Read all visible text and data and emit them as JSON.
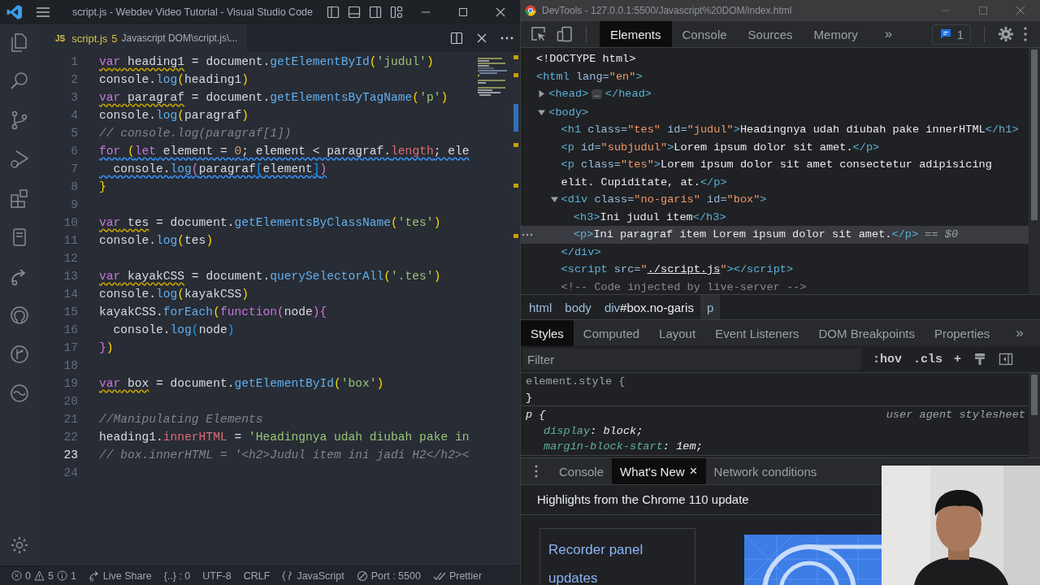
{
  "vscode": {
    "title": "script.js - Webdev Video Tutorial - Visual Studio Code",
    "tab": {
      "badge": "JS",
      "name": "script.js",
      "problems": "5",
      "path": "Javascript DOM\\script.js\\..."
    },
    "lines": [
      {
        "number": "1",
        "current": false,
        "tokens": [
          {
            "kind": "keyword",
            "text": "var",
            "warning": true
          },
          {
            "kind": "ident",
            "text": " heading1",
            "warning": true
          },
          {
            "kind": "ident",
            "text": " = document."
          },
          {
            "kind": "function",
            "text": "getElementById"
          },
          {
            "kind": "bracket1",
            "text": "("
          },
          {
            "kind": "string",
            "text": "'judul'"
          },
          {
            "kind": "bracket1",
            "text": ")"
          }
        ]
      },
      {
        "number": "2",
        "current": false,
        "tokens": [
          {
            "kind": "ident",
            "text": "console."
          },
          {
            "kind": "function",
            "text": "log"
          },
          {
            "kind": "bracket1",
            "text": "("
          },
          {
            "kind": "ident",
            "text": "heading1"
          },
          {
            "kind": "bracket1",
            "text": ")"
          }
        ]
      },
      {
        "number": "3",
        "current": false,
        "tokens": [
          {
            "kind": "keyword",
            "text": "var",
            "warning": true
          },
          {
            "kind": "ident",
            "text": " paragraf",
            "warning": true
          },
          {
            "kind": "ident",
            "text": " = document."
          },
          {
            "kind": "function",
            "text": "getElementsByTagName"
          },
          {
            "kind": "bracket1",
            "text": "("
          },
          {
            "kind": "string",
            "text": "'p'"
          },
          {
            "kind": "bracket1",
            "text": ")"
          }
        ]
      },
      {
        "number": "4",
        "current": false,
        "tokens": [
          {
            "kind": "ident",
            "text": "console."
          },
          {
            "kind": "function",
            "text": "log"
          },
          {
            "kind": "bracket1",
            "text": "("
          },
          {
            "kind": "ident",
            "text": "paragraf"
          },
          {
            "kind": "bracket1",
            "text": ")"
          }
        ]
      },
      {
        "number": "5",
        "current": false,
        "tokens": [
          {
            "kind": "comment",
            "text": "// console.log(paragraf[1])"
          }
        ]
      },
      {
        "number": "6",
        "current": false,
        "tokens": [
          {
            "kind": "keyword",
            "text": "for",
            "info": true
          },
          {
            "kind": "bracket1",
            "text": " (",
            "info": true
          },
          {
            "kind": "keyword",
            "text": "let",
            "info": true
          },
          {
            "kind": "ident",
            "text": " element = ",
            "info": true
          },
          {
            "kind": "number",
            "text": "0",
            "info": true
          },
          {
            "kind": "ident",
            "text": "; element < paragraf.",
            "info": true
          },
          {
            "kind": "property",
            "text": "length",
            "info": true
          },
          {
            "kind": "ident",
            "text": "; ele",
            "info": true
          }
        ]
      },
      {
        "number": "7",
        "current": false,
        "tokens": [
          {
            "kind": "ident",
            "text": "  console.",
            "info": true
          },
          {
            "kind": "function",
            "text": "log",
            "info": true
          },
          {
            "kind": "bracket2",
            "text": "(",
            "info": true
          },
          {
            "kind": "ident",
            "text": "paragraf",
            "info": true
          },
          {
            "kind": "bracket3",
            "text": "[",
            "info": true
          },
          {
            "kind": "ident",
            "text": "element",
            "info": true
          },
          {
            "kind": "bracket3",
            "text": "]",
            "info": true
          },
          {
            "kind": "bracket2",
            "text": ")",
            "info": true
          }
        ]
      },
      {
        "number": "8",
        "current": false,
        "tokens": [
          {
            "kind": "bracket1",
            "text": "}"
          }
        ]
      },
      {
        "number": "9",
        "current": false
      },
      {
        "number": "10",
        "current": false,
        "tokens": [
          {
            "kind": "keyword",
            "text": "var",
            "warning": true
          },
          {
            "kind": "ident",
            "text": " tes",
            "warning": true
          },
          {
            "kind": "ident",
            "text": " = document."
          },
          {
            "kind": "function",
            "text": "getElementsByClassName"
          },
          {
            "kind": "bracket1",
            "text": "("
          },
          {
            "kind": "string",
            "text": "'tes'"
          },
          {
            "kind": "bracket1",
            "text": ")"
          }
        ]
      },
      {
        "number": "11",
        "current": false,
        "tokens": [
          {
            "kind": "ident",
            "text": "console."
          },
          {
            "kind": "function",
            "text": "log"
          },
          {
            "kind": "bracket1",
            "text": "("
          },
          {
            "kind": "ident",
            "text": "tes"
          },
          {
            "kind": "bracket1",
            "text": ")"
          }
        ]
      },
      {
        "number": "12",
        "current": false
      },
      {
        "number": "13",
        "current": false,
        "tokens": [
          {
            "kind": "keyword",
            "text": "var",
            "warning": true
          },
          {
            "kind": "ident",
            "text": " kayakCSS",
            "warning": true
          },
          {
            "kind": "ident",
            "text": " = document."
          },
          {
            "kind": "function",
            "text": "querySelectorAll"
          },
          {
            "kind": "bracket1",
            "text": "("
          },
          {
            "kind": "string",
            "text": "'.tes'"
          },
          {
            "kind": "bracket1",
            "text": ")"
          }
        ]
      },
      {
        "number": "14",
        "current": false,
        "tokens": [
          {
            "kind": "ident",
            "text": "console."
          },
          {
            "kind": "function",
            "text": "log"
          },
          {
            "kind": "bracket1",
            "text": "("
          },
          {
            "kind": "ident",
            "text": "kayakCSS"
          },
          {
            "kind": "bracket1",
            "text": ")"
          }
        ]
      },
      {
        "number": "15",
        "current": false,
        "tokens": [
          {
            "kind": "ident",
            "text": "kayakCSS."
          },
          {
            "kind": "function",
            "text": "forEach"
          },
          {
            "kind": "bracket1",
            "text": "("
          },
          {
            "kind": "keyword",
            "text": "function"
          },
          {
            "kind": "bracket2",
            "text": "("
          },
          {
            "kind": "ident",
            "text": "node"
          },
          {
            "kind": "bracket2",
            "text": ")"
          },
          {
            "kind": "bracket2",
            "text": "{"
          }
        ]
      },
      {
        "number": "16",
        "current": false,
        "tokens": [
          {
            "kind": "ident",
            "text": "  console."
          },
          {
            "kind": "function",
            "text": "log"
          },
          {
            "kind": "bracket3",
            "text": "("
          },
          {
            "kind": "ident",
            "text": "node"
          },
          {
            "kind": "bracket3",
            "text": ")"
          }
        ]
      },
      {
        "number": "17",
        "current": false,
        "tokens": [
          {
            "kind": "bracket2",
            "text": "}"
          },
          {
            "kind": "bracket1",
            "text": ")"
          }
        ]
      },
      {
        "number": "18",
        "current": false
      },
      {
        "number": "19",
        "current": false,
        "tokens": [
          {
            "kind": "keyword",
            "text": "var",
            "warning": true
          },
          {
            "kind": "ident",
            "text": " box",
            "warning": true
          },
          {
            "kind": "ident",
            "text": " = document."
          },
          {
            "kind": "function",
            "text": "getElementById"
          },
          {
            "kind": "bracket1",
            "text": "("
          },
          {
            "kind": "string",
            "text": "'box'"
          },
          {
            "kind": "bracket1",
            "text": ")"
          }
        ]
      },
      {
        "number": "20",
        "current": false
      },
      {
        "number": "21",
        "current": false,
        "tokens": [
          {
            "kind": "comment",
            "text": "//Manipulating Elements"
          }
        ]
      },
      {
        "number": "22",
        "current": false,
        "tokens": [
          {
            "kind": "ident",
            "text": "heading1."
          },
          {
            "kind": "property",
            "text": "innerHTML"
          },
          {
            "kind": "ident",
            "text": " = "
          },
          {
            "kind": "string",
            "text": "'Headingnya udah diubah pake in"
          }
        ]
      },
      {
        "number": "23",
        "current": true,
        "tokens": [
          {
            "kind": "comment",
            "text": "// box.innerHTML = '<h2>Judul item ini jadi H2</h2><"
          }
        ]
      },
      {
        "number": "24",
        "current": false
      }
    ],
    "status_bar": {
      "errors": "0",
      "warnings": "5",
      "infos": "1",
      "items": [
        {
          "kind": "live-share",
          "text": "Live Share"
        },
        {
          "kind": "plain",
          "text": "{..} : 0"
        },
        {
          "kind": "plain",
          "text": "UTF-8"
        },
        {
          "kind": "plain",
          "text": "CRLF"
        },
        {
          "kind": "language",
          "text": "JavaScript"
        },
        {
          "kind": "port",
          "text": "Port : 5500"
        },
        {
          "kind": "prettier",
          "text": "Prettier"
        }
      ]
    }
  },
  "devtools": {
    "title": "DevTools - 127.0.0.1:5500/Javascript%20DOM/index.html",
    "tabs": [
      {
        "label": "Elements",
        "selected": true
      },
      {
        "label": "Console",
        "selected": false
      },
      {
        "label": "Sources",
        "selected": false
      },
      {
        "label": "Memory",
        "selected": false
      }
    ],
    "more_tabs": "»",
    "issues": "1",
    "dom": [
      {
        "tokens": [
          {
            "kind": "doctype",
            "text": "<!DOCTYPE html>"
          }
        ]
      },
      {
        "tokens": [
          {
            "kind": "tag",
            "text": "<html"
          },
          {
            "kind": "attr",
            "text": " lang="
          },
          {
            "kind": "value",
            "text": "\"en\""
          },
          {
            "kind": "tag",
            "text": ">"
          }
        ],
        "children": [
          {
            "expanded": false,
            "tokens": [
              {
                "kind": "tag",
                "text": "<head>"
              },
              {
                "kind": "ellipsis",
                "text": "…"
              },
              {
                "kind": "tag",
                "text": "</head>"
              }
            ]
          },
          {
            "expanded": true,
            "tokens": [
              {
                "kind": "tag",
                "text": "<body>"
              }
            ],
            "children": [
              {
                "tokens": [
                  {
                    "kind": "tag",
                    "text": "<h1"
                  },
                  {
                    "kind": "attr",
                    "text": " class="
                  },
                  {
                    "kind": "value",
                    "text": "\"tes\""
                  },
                  {
                    "kind": "attr",
                    "text": " id="
                  },
                  {
                    "kind": "value",
                    "text": "\"judul\""
                  },
                  {
                    "kind": "tag",
                    "text": ">"
                  },
                  {
                    "kind": "text",
                    "text": "Headingnya udah diubah pake innerHTML"
                  },
                  {
                    "kind": "tag",
                    "text": "</h1>"
                  }
                ]
              },
              {
                "tokens": [
                  {
                    "kind": "tag",
                    "text": "<p"
                  },
                  {
                    "kind": "attr",
                    "text": " id="
                  },
                  {
                    "kind": "value",
                    "text": "\"subjudul\""
                  },
                  {
                    "kind": "tag",
                    "text": ">"
                  },
                  {
                    "kind": "text",
                    "text": "Lorem ipsum dolor sit amet."
                  },
                  {
                    "kind": "tag",
                    "text": "</p>"
                  }
                ]
              },
              {
                "tokens": [
                  {
                    "kind": "tag",
                    "text": "<p"
                  },
                  {
                    "kind": "attr",
                    "text": " class="
                  },
                  {
                    "kind": "value",
                    "text": "\"tes\""
                  },
                  {
                    "kind": "tag",
                    "text": ">"
                  },
                  {
                    "kind": "text",
                    "text": "Lorem ipsum dolor sit amet consectetur adipisicing elit. Cupiditate, at."
                  },
                  {
                    "kind": "tag",
                    "text": "</p>"
                  }
                ]
              },
              {
                "expanded": true,
                "closing": "</div>",
                "tokens": [
                  {
                    "kind": "tag",
                    "text": "<div"
                  },
                  {
                    "kind": "attr",
                    "text": " class="
                  },
                  {
                    "kind": "value",
                    "text": "\"no-garis\""
                  },
                  {
                    "kind": "attr",
                    "text": " id="
                  },
                  {
                    "kind": "value",
                    "text": "\"box\""
                  },
                  {
                    "kind": "tag",
                    "text": ">"
                  }
                ],
                "children": [
                  {
                    "selected": false,
                    "tokens": [
                      {
                        "kind": "tag",
                        "text": "<h3>"
                      },
                      {
                        "kind": "text",
                        "text": "Ini judul item"
                      },
                      {
                        "kind": "tag",
                        "text": "</h3>"
                      }
                    ]
                  },
                  {
                    "selected": true,
                    "tokens": [
                      {
                        "kind": "tag",
                        "text": "<p>"
                      },
                      {
                        "kind": "text",
                        "text": "Ini paragraf item Lorem ipsum dolor sit amet."
                      },
                      {
                        "kind": "tag",
                        "text": "</p>"
                      },
                      {
                        "kind": "marker",
                        "text": " == $0"
                      }
                    ]
                  }
                ]
              },
              {
                "tokens": [
                  {
                    "kind": "tag",
                    "text": "<script"
                  },
                  {
                    "kind": "attr",
                    "text": " src="
                  },
                  {
                    "kind": "value",
                    "text": "\""
                  },
                  {
                    "kind": "link",
                    "text": "./script.js"
                  },
                  {
                    "kind": "value",
                    "text": "\""
                  },
                  {
                    "kind": "tag",
                    "text": "></script>"
                  }
                ]
              },
              {
                "tokens": [
                  {
                    "kind": "comment",
                    "text": "<!-- Code injected by live-server -->"
                  }
                ]
              }
            ]
          }
        ]
      }
    ],
    "breadcrumbs": [
      {
        "tag": "html",
        "selected": false
      },
      {
        "tag": "body",
        "selected": false
      },
      {
        "tag": "div",
        "detail": "#box.no-garis",
        "selected": false
      },
      {
        "tag": "p",
        "selected": true
      }
    ],
    "style_tabs": [
      {
        "label": "Styles",
        "selected": true
      },
      {
        "label": "Computed",
        "selected": false
      },
      {
        "label": "Layout",
        "selected": false
      },
      {
        "label": "Event Listeners",
        "selected": false
      },
      {
        "label": "DOM Breakpoints",
        "selected": false
      },
      {
        "label": "Properties",
        "selected": false
      }
    ],
    "style_more": "»",
    "filter": {
      "placeholder": "Filter"
    },
    "filter_buttons": [
      ":hov",
      ".cls",
      "+"
    ],
    "rules": [
      {
        "selector": "element.style",
        "open": " {",
        "close": "}"
      },
      {
        "selector": "p",
        "open": " {",
        "source": "user agent stylesheet",
        "declarations": [
          {
            "property": "display",
            "value": ": block;"
          },
          {
            "property": "margin-block-start",
            "value": ": 1em;"
          }
        ]
      }
    ],
    "drawer": {
      "tabs": [
        {
          "label": "Console",
          "selected": false
        },
        {
          "label": "What's New",
          "selected": true,
          "close": "×"
        },
        {
          "label": "Network conditions",
          "selected": false
        }
      ],
      "heading": "Highlights from the Chrome 110 update",
      "card": "Recorder panel updates"
    }
  }
}
